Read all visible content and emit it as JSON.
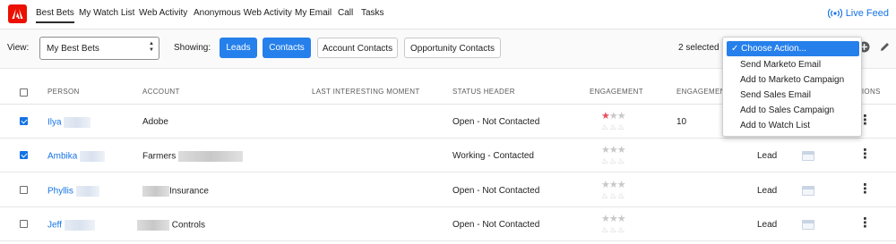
{
  "nav": {
    "tabs": [
      {
        "label": "Best Bets"
      },
      {
        "label": "My Watch List"
      },
      {
        "label": "Web Activity"
      },
      {
        "label": "Anonymous Web Activity"
      },
      {
        "label": "My Email"
      },
      {
        "label": "Call"
      },
      {
        "label": "Tasks"
      }
    ],
    "active_tab": "Best Bets",
    "live_feed_label": "Live Feed"
  },
  "toolbar": {
    "view_label": "View:",
    "view_value": "My Best Bets",
    "showing_label": "Showing:",
    "filters": [
      {
        "label": "Leads",
        "active": true
      },
      {
        "label": "Contacts",
        "active": true
      },
      {
        "label": "Account Contacts",
        "active": false
      },
      {
        "label": "Opportunity Contacts",
        "active": false
      }
    ],
    "selected_text": "2 selected"
  },
  "action_menu": {
    "selected": "Choose Action...",
    "options": [
      "Send Marketo Email",
      "Add to Marketo Campaign",
      "Send Sales Email",
      "Add to Sales Campaign",
      "Add to Watch List"
    ]
  },
  "table": {
    "columns": [
      "PERSON",
      "ACCOUNT",
      "LAST INTERESTING MOMENT",
      "STATUS HEADER",
      "ENGAGEMENT",
      "ENGAGEMENT",
      "ACTIONS"
    ],
    "rows": [
      {
        "checked": true,
        "person": "Ilya",
        "account": "Adobe",
        "account_prefix": "",
        "status": "Open - Not Contacted",
        "stars_filled": 1,
        "engagement_value": "10",
        "type": ""
      },
      {
        "checked": true,
        "person": "Ambika",
        "account": "Farmers",
        "account_prefix": "",
        "status": "Working - Contacted",
        "stars_filled": 0,
        "engagement_value": "",
        "type": "Lead"
      },
      {
        "checked": false,
        "person": "Phyllis",
        "account": "Insurance",
        "account_prefix": "blur",
        "status": "Open - Not Contacted",
        "stars_filled": 0,
        "engagement_value": "",
        "type": "Lead"
      },
      {
        "checked": false,
        "person": "Jeff",
        "account": "Controls",
        "account_prefix": "blur",
        "status": "Open - Not Contacted",
        "stars_filled": 0,
        "engagement_value": "",
        "type": "Lead"
      }
    ]
  },
  "colors": {
    "brand": "#eb1000",
    "accent": "#2680eb",
    "link": "#1473e6",
    "star_filled": "#e8505b"
  },
  "icons": [
    "adobe-logo-icon",
    "live-feed-icon",
    "stepper-arrows-icon",
    "add-icon",
    "edit-icon",
    "star-icon",
    "flame-icon",
    "calendar-icon",
    "more-vertical-icon",
    "checkmark-icon"
  ]
}
